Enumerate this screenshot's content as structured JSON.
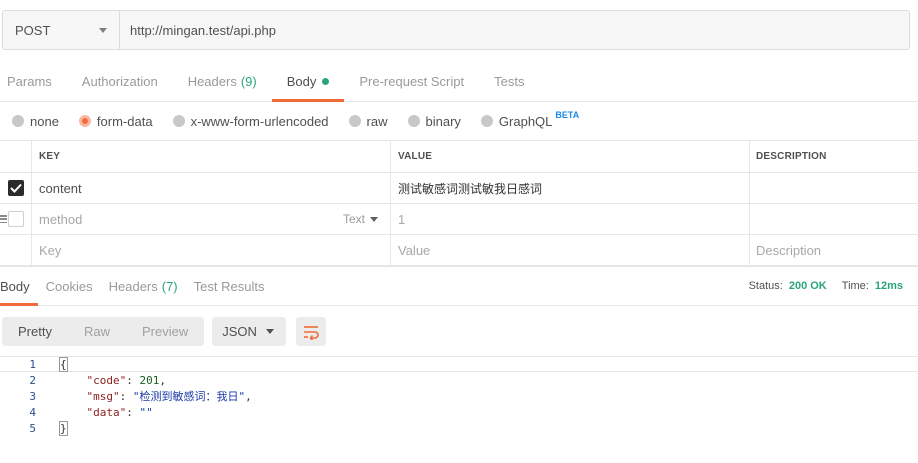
{
  "request": {
    "method": "POST",
    "url": "http://mingan.test/api.php"
  },
  "request_tabs": [
    {
      "label": "Params"
    },
    {
      "label": "Authorization"
    },
    {
      "label": "Headers",
      "count": "(9)"
    },
    {
      "label": "Body"
    },
    {
      "label": "Pre-request Script"
    },
    {
      "label": "Tests"
    }
  ],
  "body_types": [
    {
      "label": "none"
    },
    {
      "label": "form-data"
    },
    {
      "label": "x-www-form-urlencoded"
    },
    {
      "label": "raw"
    },
    {
      "label": "binary"
    },
    {
      "label": "GraphQL",
      "badge": "BETA"
    }
  ],
  "table": {
    "headers": {
      "key": "KEY",
      "value": "VALUE",
      "description": "DESCRIPTION"
    },
    "rows": [
      {
        "key": "content",
        "value": "测试敏感词测试敏我日感词"
      },
      {
        "key": "method",
        "type": "Text",
        "value": "1"
      }
    ],
    "placeholders": {
      "key": "Key",
      "value": "Value",
      "description": "Description"
    }
  },
  "response": {
    "tabs": [
      {
        "label": "Body"
      },
      {
        "label": "Cookies"
      },
      {
        "label": "Headers",
        "count": "(7)"
      },
      {
        "label": "Test Results"
      }
    ],
    "status_label": "Status:",
    "status_value": "200 OK",
    "time_label": "Time:",
    "time_value": "12ms",
    "views": [
      "Pretty",
      "Raw",
      "Preview"
    ],
    "format": "JSON",
    "lines": [
      {
        "n": "1"
      },
      {
        "n": "2",
        "key": "\"code\"",
        "value": "201",
        "trail": ","
      },
      {
        "n": "3",
        "key": "\"msg\"",
        "value": "\"检测到敏感词：我日\"",
        "trail": ","
      },
      {
        "n": "4",
        "key": "\"data\"",
        "value": "\"\""
      },
      {
        "n": "5"
      }
    ],
    "open_brace": "{",
    "close_brace": "}"
  },
  "colors": {
    "accent": "#f26b3a",
    "success": "#2aa57a",
    "beta": "#1e88e5"
  },
  "icons": [
    "chevron-down-icon",
    "checkmark-icon",
    "drag-handle-icon",
    "wrap-lines-icon"
  ]
}
